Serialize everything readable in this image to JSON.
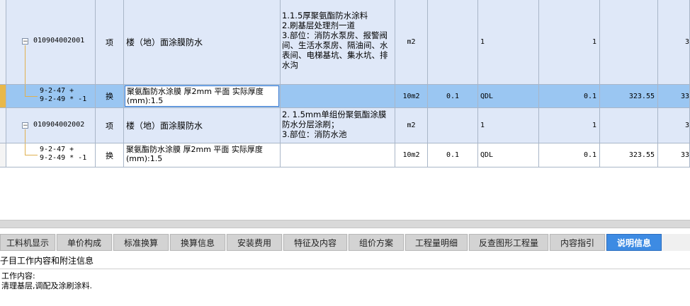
{
  "rows": [
    {
      "type": "list",
      "code": "010904002001",
      "category": "项",
      "name": "楼（地）面涂膜防水",
      "features": [
        "1.1.5厚聚氨酯防水涂料",
        "2.刷基层处理剂一道",
        "3.部位：消防水泵房、报警阀间、生活水泵房、隔油间、水表间、电梯基坑、集水坑、排水沟"
      ],
      "unit": "m2",
      "coef": "",
      "expr": "1",
      "qty": "1",
      "price": "",
      "total": "3"
    },
    {
      "type": "sub-selected",
      "code": [
        "9-2-47 +",
        "9-2-49 * -1"
      ],
      "category": "换",
      "name": "聚氨酯防水涂膜 厚2mm 平面  实际厚度(mm):1.5",
      "features": [],
      "unit": "10m2",
      "coef": "0.1",
      "expr": "QDL",
      "qty": "0.1",
      "price": "323.55",
      "total": "33"
    },
    {
      "type": "list",
      "code": "010904002002",
      "category": "项",
      "name": "楼（地）面涂膜防水",
      "features": [
        "2. 1.5mm单组份聚氨酯涂膜防水分层涂刷；",
        "3.部位：消防水池"
      ],
      "unit": "m2",
      "coef": "",
      "expr": "1",
      "qty": "1",
      "price": "",
      "total": "3"
    },
    {
      "type": "sub",
      "code": [
        "9-2-47 +",
        "9-2-49 * -1"
      ],
      "category": "换",
      "name": "聚氨酯防水涂膜 厚2mm 平面  实际厚度(mm):1.5",
      "features": [],
      "unit": "10m2",
      "coef": "0.1",
      "expr": "QDL",
      "qty": "0.1",
      "price": "323.55",
      "total": "33"
    }
  ],
  "tree_toggle": "−",
  "tabs": [
    {
      "label": "工料机显示",
      "active": false
    },
    {
      "label": "单价构成",
      "active": false
    },
    {
      "label": "标准换算",
      "active": false
    },
    {
      "label": "换算信息",
      "active": false
    },
    {
      "label": "安装费用",
      "active": false
    },
    {
      "label": "特征及内容",
      "active": false
    },
    {
      "label": "组价方案",
      "active": false
    },
    {
      "label": "工程量明细",
      "active": false
    },
    {
      "label": "反查图形工程量",
      "active": false
    },
    {
      "label": "内容指引",
      "active": false
    },
    {
      "label": "说明信息",
      "active": true
    }
  ],
  "info": {
    "title": "子目工作内容和附注信息",
    "work_label": "工作内容:",
    "work_text": "清理基层,调配及涂刷涂料."
  },
  "colors": {
    "list_row": "#dfe8f8",
    "selected_row": "#9ac6f2",
    "active_tab": "#3d8be3"
  }
}
